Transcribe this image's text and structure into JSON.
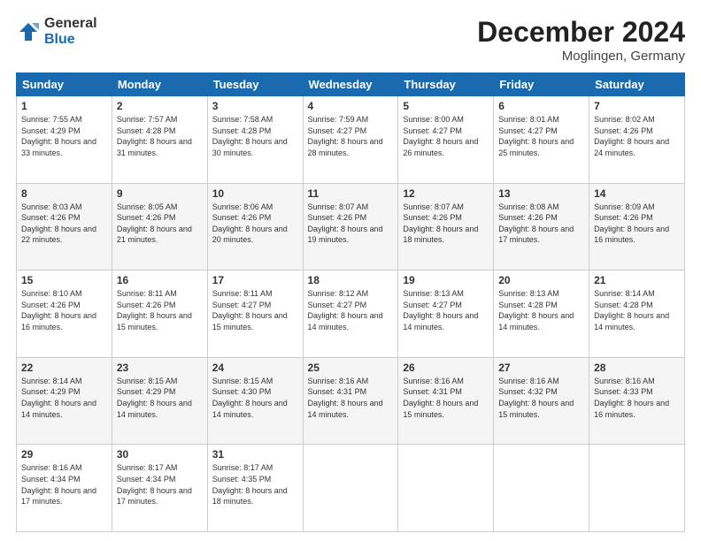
{
  "header": {
    "logo_general": "General",
    "logo_blue": "Blue",
    "month_title": "December 2024",
    "subtitle": "Moglingen, Germany"
  },
  "days_of_week": [
    "Sunday",
    "Monday",
    "Tuesday",
    "Wednesday",
    "Thursday",
    "Friday",
    "Saturday"
  ],
  "weeks": [
    [
      {
        "day": "1",
        "sunrise": "7:55 AM",
        "sunset": "4:29 PM",
        "daylight": "8 hours and 33 minutes."
      },
      {
        "day": "2",
        "sunrise": "7:57 AM",
        "sunset": "4:28 PM",
        "daylight": "8 hours and 31 minutes."
      },
      {
        "day": "3",
        "sunrise": "7:58 AM",
        "sunset": "4:28 PM",
        "daylight": "8 hours and 30 minutes."
      },
      {
        "day": "4",
        "sunrise": "7:59 AM",
        "sunset": "4:27 PM",
        "daylight": "8 hours and 28 minutes."
      },
      {
        "day": "5",
        "sunrise": "8:00 AM",
        "sunset": "4:27 PM",
        "daylight": "8 hours and 26 minutes."
      },
      {
        "day": "6",
        "sunrise": "8:01 AM",
        "sunset": "4:27 PM",
        "daylight": "8 hours and 25 minutes."
      },
      {
        "day": "7",
        "sunrise": "8:02 AM",
        "sunset": "4:26 PM",
        "daylight": "8 hours and 24 minutes."
      }
    ],
    [
      {
        "day": "8",
        "sunrise": "8:03 AM",
        "sunset": "4:26 PM",
        "daylight": "8 hours and 22 minutes."
      },
      {
        "day": "9",
        "sunrise": "8:05 AM",
        "sunset": "4:26 PM",
        "daylight": "8 hours and 21 minutes."
      },
      {
        "day": "10",
        "sunrise": "8:06 AM",
        "sunset": "4:26 PM",
        "daylight": "8 hours and 20 minutes."
      },
      {
        "day": "11",
        "sunrise": "8:07 AM",
        "sunset": "4:26 PM",
        "daylight": "8 hours and 19 minutes."
      },
      {
        "day": "12",
        "sunrise": "8:07 AM",
        "sunset": "4:26 PM",
        "daylight": "8 hours and 18 minutes."
      },
      {
        "day": "13",
        "sunrise": "8:08 AM",
        "sunset": "4:26 PM",
        "daylight": "8 hours and 17 minutes."
      },
      {
        "day": "14",
        "sunrise": "8:09 AM",
        "sunset": "4:26 PM",
        "daylight": "8 hours and 16 minutes."
      }
    ],
    [
      {
        "day": "15",
        "sunrise": "8:10 AM",
        "sunset": "4:26 PM",
        "daylight": "8 hours and 16 minutes."
      },
      {
        "day": "16",
        "sunrise": "8:11 AM",
        "sunset": "4:26 PM",
        "daylight": "8 hours and 15 minutes."
      },
      {
        "day": "17",
        "sunrise": "8:11 AM",
        "sunset": "4:27 PM",
        "daylight": "8 hours and 15 minutes."
      },
      {
        "day": "18",
        "sunrise": "8:12 AM",
        "sunset": "4:27 PM",
        "daylight": "8 hours and 14 minutes."
      },
      {
        "day": "19",
        "sunrise": "8:13 AM",
        "sunset": "4:27 PM",
        "daylight": "8 hours and 14 minutes."
      },
      {
        "day": "20",
        "sunrise": "8:13 AM",
        "sunset": "4:28 PM",
        "daylight": "8 hours and 14 minutes."
      },
      {
        "day": "21",
        "sunrise": "8:14 AM",
        "sunset": "4:28 PM",
        "daylight": "8 hours and 14 minutes."
      }
    ],
    [
      {
        "day": "22",
        "sunrise": "8:14 AM",
        "sunset": "4:29 PM",
        "daylight": "8 hours and 14 minutes."
      },
      {
        "day": "23",
        "sunrise": "8:15 AM",
        "sunset": "4:29 PM",
        "daylight": "8 hours and 14 minutes."
      },
      {
        "day": "24",
        "sunrise": "8:15 AM",
        "sunset": "4:30 PM",
        "daylight": "8 hours and 14 minutes."
      },
      {
        "day": "25",
        "sunrise": "8:16 AM",
        "sunset": "4:31 PM",
        "daylight": "8 hours and 14 minutes."
      },
      {
        "day": "26",
        "sunrise": "8:16 AM",
        "sunset": "4:31 PM",
        "daylight": "8 hours and 15 minutes."
      },
      {
        "day": "27",
        "sunrise": "8:16 AM",
        "sunset": "4:32 PM",
        "daylight": "8 hours and 15 minutes."
      },
      {
        "day": "28",
        "sunrise": "8:16 AM",
        "sunset": "4:33 PM",
        "daylight": "8 hours and 16 minutes."
      }
    ],
    [
      {
        "day": "29",
        "sunrise": "8:16 AM",
        "sunset": "4:34 PM",
        "daylight": "8 hours and 17 minutes."
      },
      {
        "day": "30",
        "sunrise": "8:17 AM",
        "sunset": "4:34 PM",
        "daylight": "8 hours and 17 minutes."
      },
      {
        "day": "31",
        "sunrise": "8:17 AM",
        "sunset": "4:35 PM",
        "daylight": "8 hours and 18 minutes."
      },
      null,
      null,
      null,
      null
    ]
  ]
}
